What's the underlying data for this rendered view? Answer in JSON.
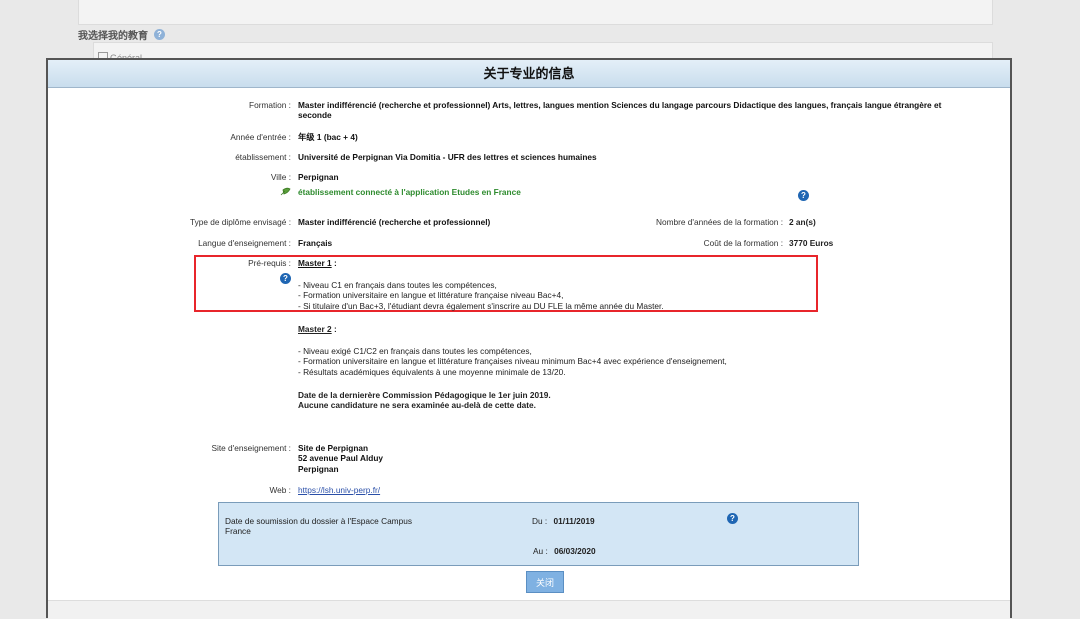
{
  "background": {
    "section_title": "我选择我的教育",
    "general_label": "Général"
  },
  "modal": {
    "title": "关于专业的信息",
    "close_label": "关闭",
    "fields": {
      "formation_label": "Formation :",
      "formation_value_1": "Master indifférencié (recherche et professionnel) Arts, lettres, langues mention Sciences du langage parcours Didactique des langues, français langue étrangère et",
      "formation_value_2": "seconde",
      "annee_label": "Année d'entrée :",
      "annee_value": "年级 1 (bac + 4)",
      "etab_label": "établissement :",
      "etab_value": "Université de Perpignan Via Domitia - UFR des lettres et sciences humaines",
      "ville_label": "Ville :",
      "ville_value": "Perpignan",
      "connected_text": "établissement connecté à l'application Etudes en France",
      "type_label": "Type de diplôme envisagé :",
      "type_value": "Master indifférencié (recherche et professionnel)",
      "nb_annees_label": "Nombre d'années de la formation :",
      "nb_annees_value": "2 an(s)",
      "langue_label": "Langue d'enseignement :",
      "langue_value": "Français",
      "cout_label": "Coût de la formation :",
      "cout_value": "3770 Euros",
      "prereq_label": "Pré-requis :",
      "master1_title": "Master 1",
      "master1_colon": " :",
      "master1_lines": [
        "- Niveau C1 en français dans toutes les compétences,",
        "- Formation universitaire en langue et littérature française niveau Bac+4,",
        "- Si titulaire d'un Bac+3, l'étudiant devra également s'inscrire au DU FLE la même année du Master."
      ],
      "master2_title": "Master 2",
      "master2_colon": " :",
      "master2_lines": [
        "- Niveau exigé C1/C2 en français dans toutes les compétences,",
        "- Formation universitaire en langue et littérature françaises niveau minimum Bac+4 avec expérience d'enseignement,",
        "- Résultats académiques équivalents à une moyenne minimale de 13/20."
      ],
      "commission_line1": "Date de la dernierère Commission Pédagogique le 1er juin 2019.",
      "commission_line2": "Aucune candidature ne sera examinée au-delà de cette date.",
      "site_label": "Site d'enseignement :",
      "site_lines": [
        "Site de Perpignan",
        "52 avenue Paul Alduy",
        "Perpignan"
      ],
      "web_label": "Web :",
      "web_value": "https://lsh.univ-perp.fr/"
    },
    "dates": {
      "submission_label_1": "Date de soumission du dossier à l'Espace Campus",
      "submission_label_2": "France",
      "du_label": "Du :",
      "du_value": "01/11/2019",
      "au_label": "Au :",
      "au_value": "06/03/2020"
    },
    "colors": {
      "accent": "#1f66b3",
      "highlight_border": "#e8252b",
      "connected_text": "#2e8b2e",
      "date_box_bg": "#d3e6f5"
    }
  }
}
